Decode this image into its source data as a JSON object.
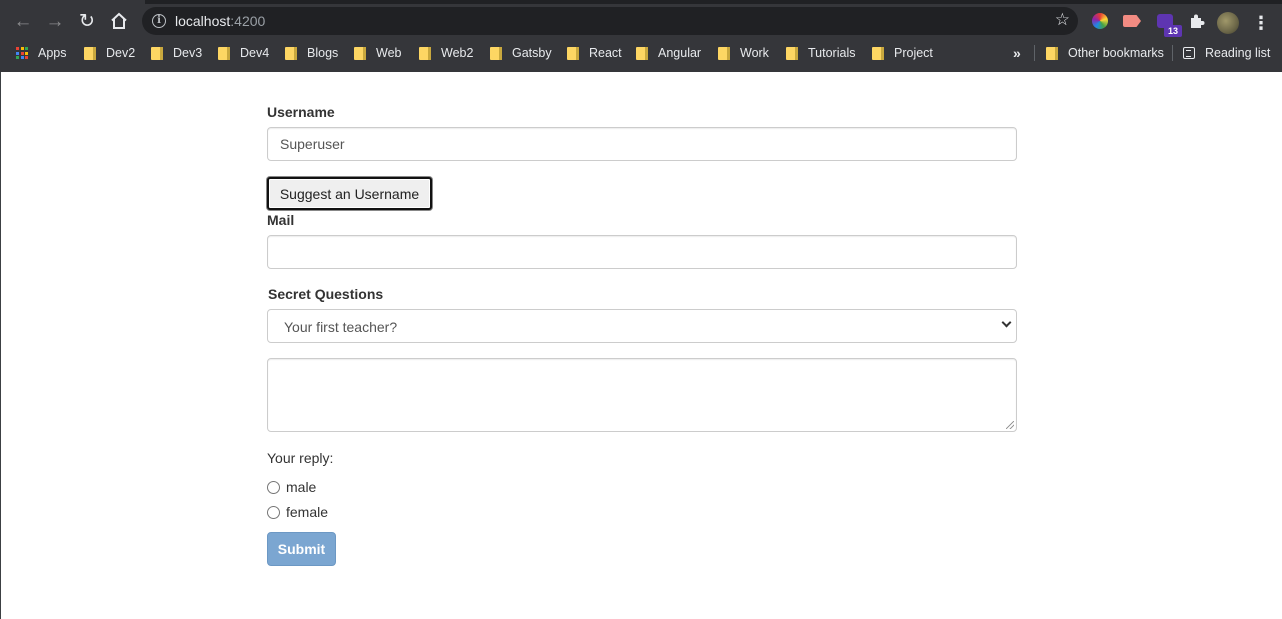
{
  "browser": {
    "url_host": "localhost",
    "url_port": ":4200",
    "extension_badge": "13",
    "bookmarks": {
      "apps": "Apps",
      "folders": [
        "Dev2",
        "Dev3",
        "Dev4",
        "Blogs",
        "Web",
        "Web2",
        "Gatsby",
        "React",
        "Angular",
        "Work",
        "Tutorials",
        "Project"
      ],
      "other": "Other bookmarks",
      "reading_list": "Reading list"
    }
  },
  "form": {
    "username_label": "Username",
    "username_value": "Superuser",
    "suggest_button": "Suggest an Username",
    "mail_label": "Mail",
    "mail_value": "",
    "secret_label": "Secret Questions",
    "secret_selected": "Your first teacher?",
    "answer_value": "",
    "reply_label": "Your reply:",
    "radio_options": [
      "male",
      "female"
    ],
    "submit_button": "Submit"
  },
  "colors": {
    "chrome_bg": "#35363a",
    "omnibox_bg": "#202124",
    "submit_bg": "#7ba6d1",
    "folder": "#fdd663"
  }
}
